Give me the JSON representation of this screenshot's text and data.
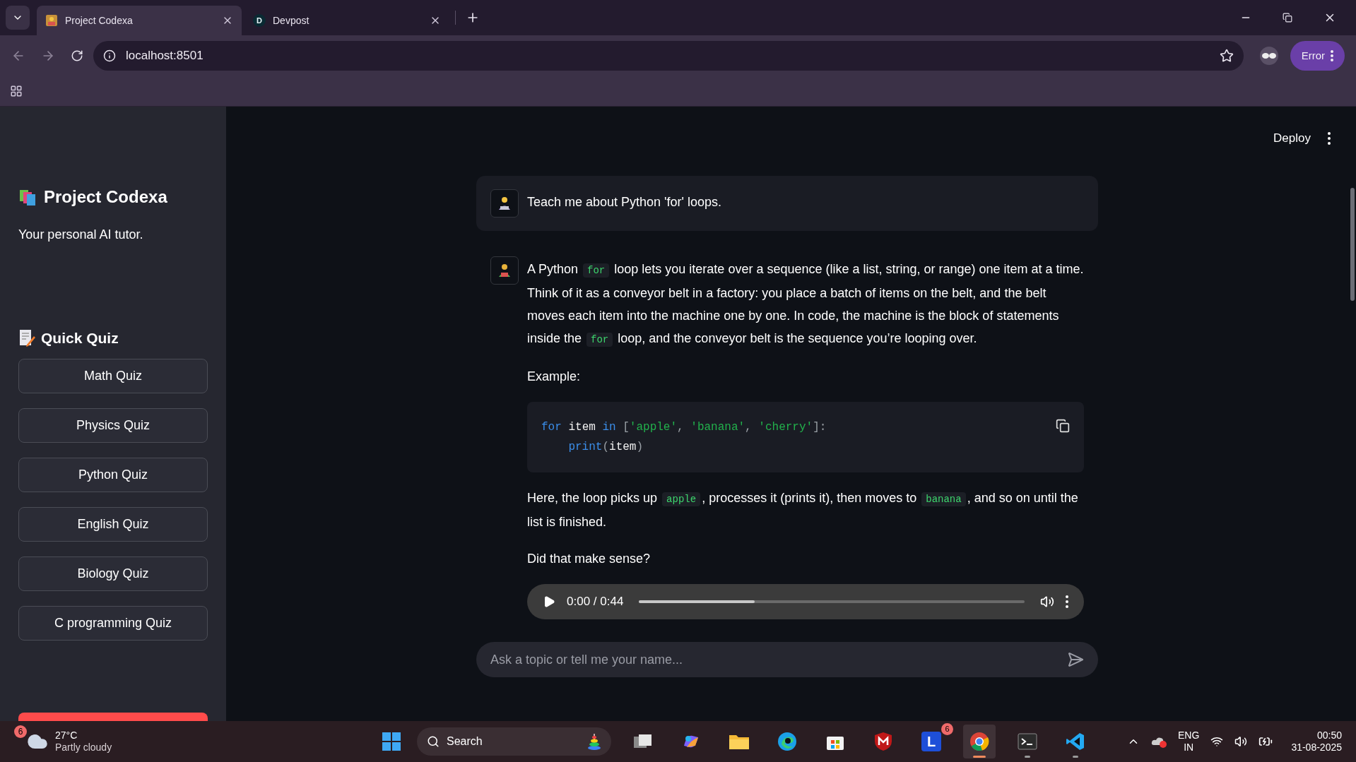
{
  "browser": {
    "tabs": [
      {
        "title": "Project Codexa",
        "selected": true,
        "kind": "app"
      },
      {
        "title": "Devpost",
        "selected": false,
        "kind": "letter",
        "letter": "D"
      }
    ],
    "address": "localhost:8501",
    "profile_button": "Error"
  },
  "sidebar": {
    "title": "Project Codexa",
    "subtitle": "Your personal AI tutor.",
    "quiz_heading": "Quick Quiz",
    "quiz_buttons": [
      "Math Quiz",
      "Physics Quiz",
      "Python Quiz",
      "English Quiz",
      "Biology Quiz",
      "C programming Quiz"
    ]
  },
  "header": {
    "deploy": "Deploy"
  },
  "messages": [
    {
      "kind": "user",
      "blocks": [
        {
          "kind": "paragraph",
          "segments": [
            {
              "kind": "text",
              "text": "Teach me about Python 'for' loops."
            }
          ]
        }
      ]
    },
    {
      "kind": "assistant",
      "blocks": [
        {
          "kind": "paragraph",
          "segments": [
            {
              "kind": "text",
              "text": "A Python "
            },
            {
              "kind": "code",
              "text": "for"
            },
            {
              "kind": "text",
              "text": " loop lets you iterate over a sequence (like a list, string, or range) one item at a time. Think of it as a conveyor belt in a factory: you place a batch of items on the belt, and the belt moves each item into the machine one by one. In code, the machine is the block of statements inside the "
            },
            {
              "kind": "code",
              "text": "for"
            },
            {
              "kind": "text",
              "text": " loop, and the conveyor belt is the sequence you’re looping over."
            }
          ]
        },
        {
          "kind": "paragraph",
          "segments": [
            {
              "kind": "text",
              "text": "Example:"
            }
          ]
        },
        {
          "kind": "code",
          "lines": [
            {
              "indented": false,
              "tokens": [
                {
                  "kind": "keyword",
                  "text": "for"
                },
                {
                  "kind": "name",
                  "text": "item"
                },
                {
                  "kind": "keyword",
                  "text": "in"
                },
                {
                  "kind": "punct",
                  "text": "["
                },
                {
                  "kind": "string",
                  "text": "'apple'"
                },
                {
                  "kind": "punct",
                  "text": ","
                },
                {
                  "kind": "string",
                  "text": "'banana'"
                },
                {
                  "kind": "punct",
                  "text": ","
                },
                {
                  "kind": "string",
                  "text": "'cherry'"
                },
                {
                  "kind": "punct",
                  "text": "]:"
                }
              ]
            },
            {
              "indented": true,
              "tokens": [
                {
                  "kind": "builtin",
                  "text": "print"
                },
                {
                  "kind": "punct",
                  "text": "("
                },
                {
                  "kind": "name",
                  "text": "item"
                },
                {
                  "kind": "punct",
                  "text": ")"
                }
              ]
            }
          ]
        },
        {
          "kind": "paragraph",
          "segments": [
            {
              "kind": "text",
              "text": "Here, the loop picks up "
            },
            {
              "kind": "code",
              "text": "apple"
            },
            {
              "kind": "text",
              "text": ", processes it (prints it), then moves to "
            },
            {
              "kind": "code",
              "text": "banana"
            },
            {
              "kind": "text",
              "text": ", and so on until the list is finished."
            }
          ]
        },
        {
          "kind": "paragraph",
          "segments": [
            {
              "kind": "text",
              "text": "Did that make sense?"
            }
          ]
        },
        {
          "kind": "audio",
          "time": "0:00 / 0:44",
          "level": 0.3
        }
      ]
    }
  ],
  "chat_input": {
    "placeholder": "Ask a topic or tell me your name..."
  },
  "taskbar": {
    "weather": {
      "badge": "6",
      "temperature": "27°C",
      "condition": "Partly cloudy"
    },
    "search": "Search",
    "apps": [
      {
        "kind": "taskview",
        "running": false,
        "selected": false
      },
      {
        "kind": "copilot",
        "running": false,
        "selected": false
      },
      {
        "kind": "folder",
        "running": false,
        "selected": false
      },
      {
        "kind": "edge",
        "running": false,
        "selected": false
      },
      {
        "kind": "store",
        "running": false,
        "selected": false
      },
      {
        "kind": "shield",
        "running": false,
        "selected": false
      },
      {
        "kind": "letter",
        "letter": "L",
        "badge": "6",
        "running": false,
        "selected": false
      },
      {
        "kind": "chrome",
        "running": true,
        "selected": true
      },
      {
        "kind": "terminal",
        "running": true,
        "selected": false
      },
      {
        "kind": "vscode",
        "running": true,
        "selected": false
      }
    ],
    "language": [
      "ENG",
      "IN"
    ],
    "time": "00:50",
    "date": "31-08-2025"
  }
}
